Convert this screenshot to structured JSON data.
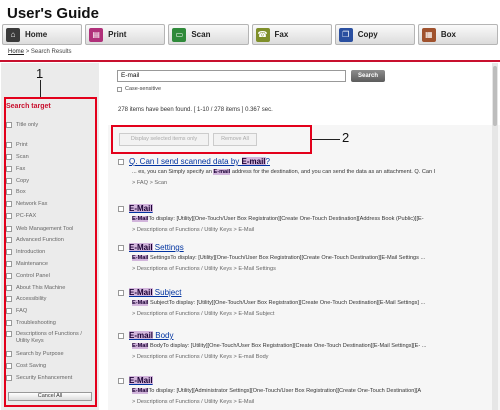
{
  "app": {
    "title": "User's Guide"
  },
  "nav": [
    {
      "label": "Home",
      "icon": "home-icon",
      "color": "#3a3a3a",
      "glyph": "⌂"
    },
    {
      "label": "Print",
      "icon": "print-icon",
      "color": "#b0307a",
      "glyph": "▤"
    },
    {
      "label": "Scan",
      "icon": "scan-icon",
      "color": "#2f8a3a",
      "glyph": "▭"
    },
    {
      "label": "Fax",
      "icon": "fax-icon",
      "color": "#7f8f2a",
      "glyph": "☎"
    },
    {
      "label": "Copy",
      "icon": "copy-icon",
      "color": "#2a4fa0",
      "glyph": "❐"
    },
    {
      "label": "Box",
      "icon": "box-icon",
      "color": "#a0522d",
      "glyph": "▦"
    }
  ],
  "breadcrumb": {
    "home": "Home",
    "sep": ">",
    "current": "Search Results"
  },
  "callouts": {
    "one": "1",
    "two": "2"
  },
  "search": {
    "value": "E-mail",
    "button": "Search",
    "case_label": "Case-sensitive"
  },
  "sidebar": {
    "title": "Search target",
    "title_only": "Title only",
    "items": [
      "Print",
      "Scan",
      "Fax",
      "Copy",
      "Box",
      "Network Fax",
      "PC-FAX",
      "Web Management Tool",
      "Advanced Function",
      "Introduction",
      "Maintenance",
      "Control Panel",
      "About This Machine",
      "Accessibility",
      "FAQ",
      "Troubleshooting",
      "Descriptions of Functions / Utility Keys",
      "Search by Purpose",
      "Cost Saving",
      "Security Enhancement"
    ],
    "cancel_all": "Cancel All"
  },
  "results_meta": {
    "count_text": "278 items have been found. [ 1-10 / 278 items ] 0.367 sec."
  },
  "results_buttons": {
    "display_selected": "Display selected items only",
    "remove_all": "Remove All"
  },
  "results": [
    {
      "title_pre": "Q. Can I send scanned data by ",
      "title_hl": "E-mail",
      "title_post": "?",
      "snippet_pre": "... es, you can Simply specify an ",
      "snippet_hl": "E-mail",
      "snippet_post": " address for the destination, and you can send the data as an attachment. Q. Can I",
      "path": "> FAQ  >  Scan"
    },
    {
      "title_pre": "",
      "title_hl": "E-Mail",
      "title_post": "",
      "snippet_pre": "",
      "snippet_hl": "E-Mail",
      "snippet_post": "To display: [Utility][One-Touch/User Box Registration][Create One-Touch Destination][Address Book (Public)][E-",
      "path": "> Descriptions of Functions / Utility Keys  >  E-Mail"
    },
    {
      "title_pre": "",
      "title_hl": "E-Mail",
      "title_post": " Settings",
      "snippet_pre": "",
      "snippet_hl": "E-Mail",
      "snippet_post": " SettingsTo display: [Utility][One-Touch/User Box Registration][Create One-Touch Destination][E-Mail Settings ...",
      "path": "> Descriptions of Functions / Utility Keys  >  E-Mail Settings"
    },
    {
      "title_pre": "",
      "title_hl": "E-Mail",
      "title_post": " Subject",
      "snippet_pre": "",
      "snippet_hl": "E-Mail",
      "snippet_post": " SubjectTo display: [Utility][One-Touch/User Box Registration][Create One-Touch Destination][E-Mail Settings] ...",
      "path": "> Descriptions of Functions / Utility Keys  >  E-Mail Subject"
    },
    {
      "title_pre": "",
      "title_hl": "E-mail",
      "title_post": " Body",
      "snippet_pre": "",
      "snippet_hl": "E-Mail",
      "snippet_post": " BodyTo display: [Utility][One-Touch/User Box Registration][Create One-Touch Destination][E-Mail Settings][E- ...",
      "path": "> Descriptions of Functions / Utility Keys  >  E-mail Body"
    },
    {
      "title_pre": "",
      "title_hl": "E-Mail",
      "title_post": "",
      "snippet_pre": "",
      "snippet_hl": "E-Mail",
      "snippet_post": "To display: [Utility][Administrator Settings][One-Touch/User Box Registration][Create One-Touch Destination][A",
      "path": "> Descriptions of Functions / Utility Keys  >  E-Mail"
    }
  ]
}
